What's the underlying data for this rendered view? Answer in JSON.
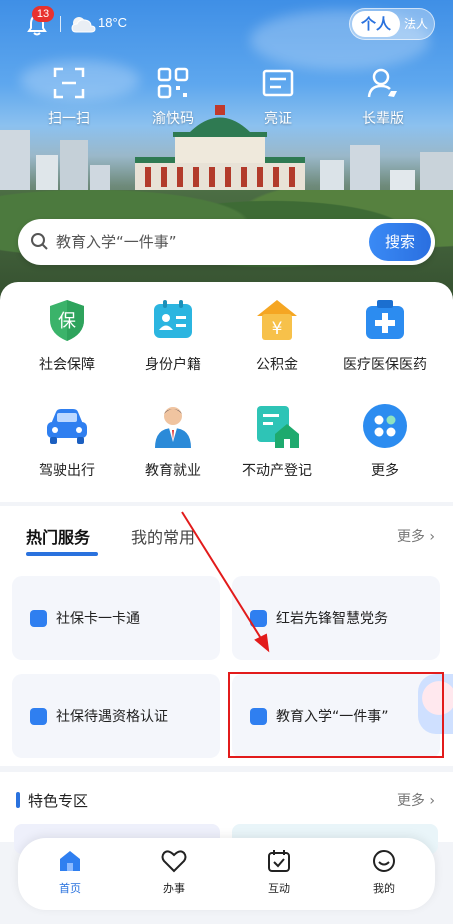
{
  "header": {
    "notification_count": "13",
    "temperature": "18°C",
    "mode_toggle": {
      "active": "个人",
      "inactive": "法人"
    }
  },
  "quick_actions": [
    {
      "label": "扫一扫",
      "icon": "scan-icon"
    },
    {
      "label": "渝快码",
      "icon": "qr-code-icon"
    },
    {
      "label": "亮证",
      "icon": "id-card-icon"
    },
    {
      "label": "长辈版",
      "icon": "elder-icon"
    }
  ],
  "search": {
    "placeholder": "教育入学“一件事”",
    "button": "搜索"
  },
  "services": [
    {
      "label": "社会保障",
      "icon": "social-security-icon"
    },
    {
      "label": "身份户籍",
      "icon": "identity-icon"
    },
    {
      "label": "公积金",
      "icon": "housing-fund-icon"
    },
    {
      "label": "医疗医保医药",
      "icon": "medical-icon"
    },
    {
      "label": "驾驶出行",
      "icon": "car-icon"
    },
    {
      "label": "教育就业",
      "icon": "education-icon"
    },
    {
      "label": "不动产登记",
      "icon": "real-estate-icon"
    },
    {
      "label": "更多",
      "icon": "more-icon"
    }
  ],
  "hot_services": {
    "tabs": [
      "热门服务",
      "我的常用"
    ],
    "more": "更多",
    "cards": [
      {
        "label": "社保卡一卡通"
      },
      {
        "label": "红岩先锋智慧党务"
      },
      {
        "label": "社保待遇资格认证"
      },
      {
        "label": "教育入学“一件事”"
      }
    ]
  },
  "special_zone": {
    "title": "特色专区",
    "more": "更多"
  },
  "bottom_nav": [
    {
      "label": "首页",
      "icon": "home-icon",
      "active": true
    },
    {
      "label": "办事",
      "icon": "heart-icon"
    },
    {
      "label": "互动",
      "icon": "calendar-check-icon"
    },
    {
      "label": "我的",
      "icon": "smile-icon"
    }
  ],
  "colors": {
    "accent": "#2a72de",
    "highlight": "#e21b1b",
    "badge": "#e8322e"
  }
}
